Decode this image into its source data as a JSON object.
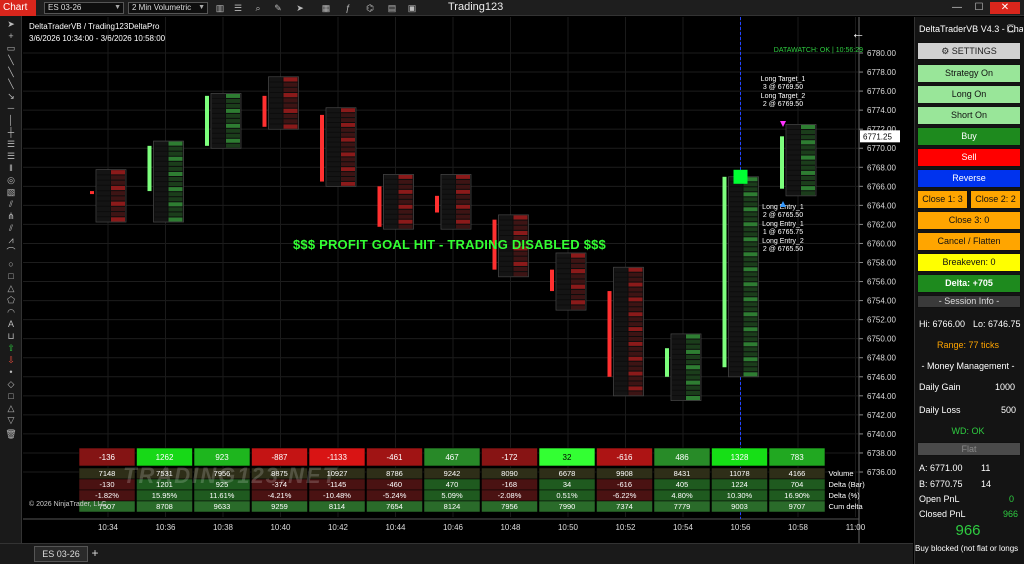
{
  "window": {
    "app_badge": "Chart",
    "instrument": "ES 03-26",
    "interval": "2 Min Volumetric",
    "title": "Trading123"
  },
  "chart": {
    "header_line1": "DeltaTraderVB / Trading123DeltaPro",
    "header_line2": "3/6/2026 10:34:00 - 3/6/2026 10:58:00",
    "datawatch": "DATAWATCH: OK | 10:56:29",
    "profit_banner": "$$$ PROFIT GOAL HIT - TRADING DISABLED $$$",
    "watermark": "TRADING123.NET",
    "copyright": "© 2026 NinjaTrader, LLC",
    "current_price_label": "6771.25",
    "annotations": [
      {
        "text": "Long Target_1",
        "sub": "3 @ 6769.50"
      },
      {
        "text": "Long Target_2",
        "sub": "2 @ 6769.50"
      },
      {
        "text": "Long Entry_1",
        "sub": "2 @ 6765.50"
      },
      {
        "text": "Long Entry_1",
        "sub": "1 @ 6765.75"
      },
      {
        "text": "Long Entry_2",
        "sub": "2 @ 6765.50"
      }
    ]
  },
  "chart_data": {
    "type": "bar",
    "price_axis": {
      "min": 6736.0,
      "max": 6780.0,
      "step": 2.0
    },
    "x_labels": [
      "10:34",
      "10:36",
      "10:38",
      "10:40",
      "10:42",
      "10:44",
      "10:46",
      "10:48",
      "10:50",
      "10:52",
      "10:54",
      "10:56",
      "10:58",
      "11:00"
    ],
    "candles": [
      {
        "time": "10:34",
        "open": 6765.25,
        "high": 6767.75,
        "low": 6762.25,
        "close": 6765.5,
        "dir": "down"
      },
      {
        "time": "10:36",
        "open": 6765.5,
        "high": 6770.75,
        "low": 6762.25,
        "close": 6770.25,
        "dir": "up"
      },
      {
        "time": "10:38",
        "open": 6770.25,
        "high": 6775.75,
        "low": 6770.0,
        "close": 6775.5,
        "dir": "up"
      },
      {
        "time": "10:40",
        "open": 6775.5,
        "high": 6777.5,
        "low": 6772.0,
        "close": 6772.25,
        "dir": "down"
      },
      {
        "time": "10:42",
        "open": 6773.5,
        "high": 6774.25,
        "low": 6766.0,
        "close": 6766.5,
        "dir": "down"
      },
      {
        "time": "10:44",
        "open": 6766.0,
        "high": 6767.25,
        "low": 6761.5,
        "close": 6761.75,
        "dir": "down"
      },
      {
        "time": "10:46",
        "open": 6765.0,
        "high": 6767.25,
        "low": 6761.5,
        "close": 6763.25,
        "dir": "down"
      },
      {
        "time": "10:48",
        "open": 6762.5,
        "high": 6763.0,
        "low": 6756.5,
        "close": 6757.25,
        "dir": "down"
      },
      {
        "time": "10:50",
        "open": 6757.25,
        "high": 6759.0,
        "low": 6753.0,
        "close": 6755.0,
        "dir": "down"
      },
      {
        "time": "10:52",
        "open": 6755.0,
        "high": 6757.5,
        "low": 6744.0,
        "close": 6746.0,
        "dir": "down"
      },
      {
        "time": "10:54",
        "open": 6746.0,
        "high": 6750.5,
        "low": 6743.5,
        "close": 6749.0,
        "dir": "up"
      },
      {
        "time": "10:56",
        "open": 6747.0,
        "high": 6767.0,
        "low": 6746.0,
        "close": 6767.0,
        "dir": "up"
      },
      {
        "time": "10:58",
        "open": 6765.75,
        "high": 6772.5,
        "low": 6765.0,
        "close": 6771.25,
        "dir": "up"
      }
    ],
    "summary_table": {
      "row_labels": [
        "Volume",
        "Delta (Bar)",
        "Delta (%)",
        "Cum delta"
      ],
      "bar_deltas": [
        -136,
        1262,
        923,
        -887,
        -1133,
        -461,
        467,
        -172,
        32,
        -616,
        486,
        1328,
        783
      ],
      "volume": [
        "7148",
        "7531",
        "7956",
        "8875",
        "10927",
        "8786",
        "9242",
        "8090",
        "6678",
        "9908",
        "8431",
        "11078",
        "4166"
      ],
      "delta_bar": [
        "-130",
        "1201",
        "925",
        "-374",
        "-1145",
        "-460",
        "470",
        "-168",
        "34",
        "-616",
        "405",
        "1224",
        "704"
      ],
      "delta_pct": [
        "-1.82%",
        "15.95%",
        "11.61%",
        "-4.21%",
        "-10.48%",
        "-5.24%",
        "5.09%",
        "-2.08%",
        "0.51%",
        "-6.22%",
        "4.80%",
        "10.30%",
        "16.90%"
      ],
      "cum_delta": [
        "7507",
        "8708",
        "9633",
        "9259",
        "8114",
        "7654",
        "8124",
        "7956",
        "7990",
        "7374",
        "7779",
        "9003",
        "9707"
      ]
    }
  },
  "panel": {
    "title": "DeltaTraderVB V4.3 - Chart",
    "settings_label": "⚙ SETTINGS",
    "buttons": {
      "strategy_on": "Strategy On",
      "long_on": "Long On",
      "short_on": "Short On",
      "buy": "Buy",
      "sell": "Sell",
      "reverse": "Reverse",
      "close_1": "Close 1: 3",
      "close_2": "Close 2: 2",
      "close_3": "Close 3: 0",
      "cancel_flatten": "Cancel / Flatten",
      "breakeven": "Breakeven: 0"
    },
    "delta_display": "Delta: +705",
    "session_info": "- Session Info -",
    "hi_label": "Hi: 6766.00",
    "lo_label": "Lo: 6746.75",
    "range_label": "Range: 77 ticks",
    "money_mgmt": "- Money Management -",
    "daily_gain_label": "Daily Gain",
    "daily_gain_value": "1000",
    "daily_loss_label": "Daily Loss",
    "daily_loss_value": "500",
    "wd_status": "WD: OK",
    "position": "Flat",
    "ask_label": "A: 6771.00",
    "ask_size": "11",
    "bid_label": "B: 6770.75",
    "bid_size": "14",
    "open_pnl_label": "Open PnL",
    "open_pnl_value": "0",
    "closed_pnl_label": "Closed PnL",
    "closed_pnl_value": "966",
    "big_pnl": "966",
    "footer_note": "Buy blocked (not flat or longs"
  },
  "tabs": {
    "active": "ES 03-26",
    "add": "+"
  }
}
